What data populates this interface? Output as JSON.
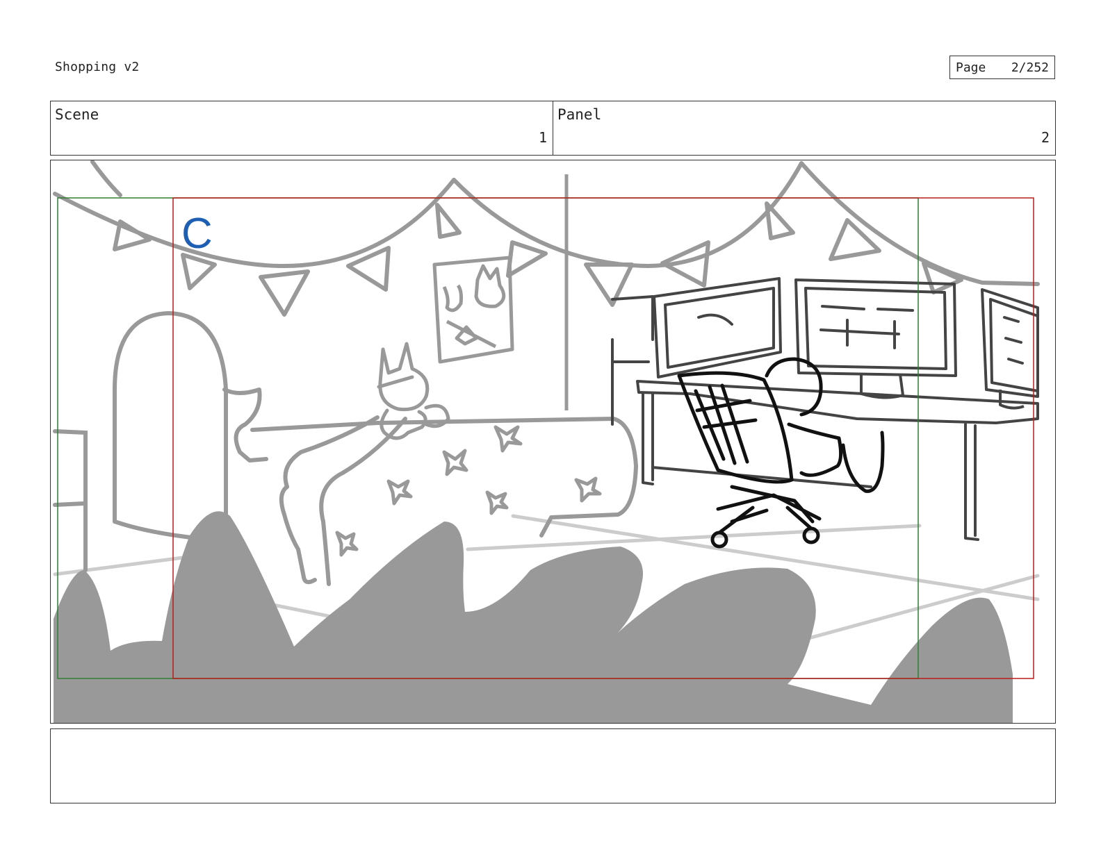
{
  "header": {
    "title": "Shopping v2",
    "page_label": "Page",
    "page_number": "2/252"
  },
  "info": {
    "scene_label": "Scene",
    "scene_value": "1",
    "panel_label": "Panel",
    "panel_value": "2"
  },
  "panel": {
    "camera_marker": "C",
    "colors": {
      "safe_frame": "#2e7d32",
      "action_frame": "#b71c1c",
      "marker": "#1e5fb4",
      "sketch_gray": "#999999",
      "sketch_dark": "#444444",
      "ink": "#111111"
    }
  },
  "notes": {
    "text": ""
  }
}
